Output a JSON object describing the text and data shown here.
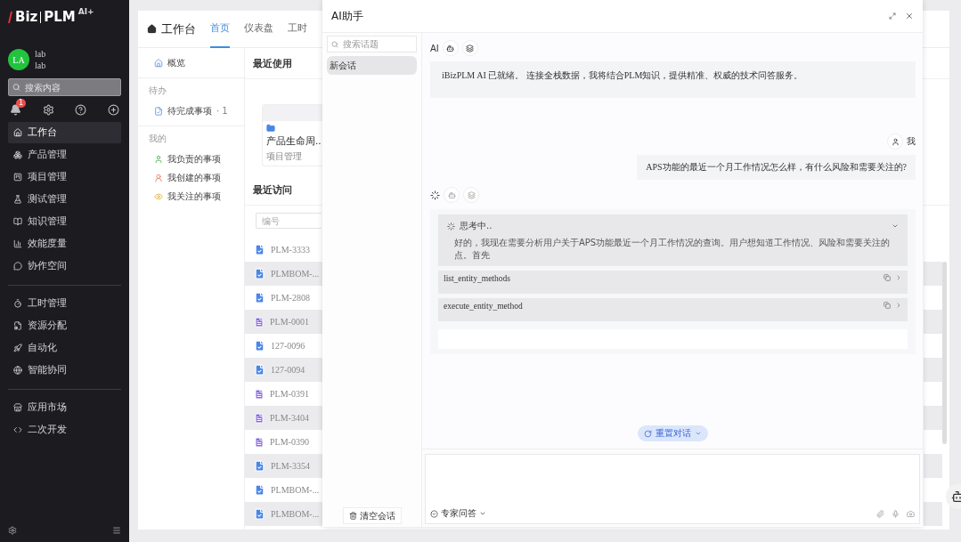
{
  "sidebar": {
    "logo": "Biz",
    "logo_product": "PLM",
    "logo_badge": "AI+",
    "user": {
      "initials": "LA",
      "name": "lab",
      "account": "lab"
    },
    "search": {
      "placeholder": "搜索内容"
    },
    "notification_count": "1",
    "nav_groups": [
      {
        "items": [
          {
            "label": "工作台",
            "selected": true
          },
          {
            "label": "产品管理",
            "selected": false
          },
          {
            "label": "项目管理",
            "selected": false
          },
          {
            "label": "测试管理",
            "selected": false
          },
          {
            "label": "知识管理",
            "selected": false
          },
          {
            "label": "效能度量",
            "selected": false
          },
          {
            "label": "协作空间",
            "selected": false
          }
        ]
      },
      {
        "items": [
          {
            "label": "工时管理",
            "selected": false
          },
          {
            "label": "资源分配",
            "selected": false
          },
          {
            "label": "自动化",
            "selected": false
          },
          {
            "label": "智能协同",
            "selected": false
          }
        ]
      },
      {
        "items": [
          {
            "label": "应用市场",
            "selected": false
          },
          {
            "label": "二次开发",
            "selected": false
          }
        ]
      }
    ]
  },
  "workbench": {
    "title": "工作台",
    "tabs": [
      {
        "label": "首页",
        "selected": true
      },
      {
        "label": "仪表盘",
        "selected": false
      },
      {
        "label": "工时",
        "selected": false
      }
    ],
    "subnav": {
      "overview": "概览",
      "sections": [
        {
          "title": "待办",
          "items": [
            {
              "label": "待完成事项",
              "count": "· 1"
            }
          ]
        },
        {
          "title": "我的",
          "items": [
            {
              "label": "我负责的事项"
            },
            {
              "label": "我创建的事项"
            },
            {
              "label": "我关注的事项"
            }
          ]
        }
      ]
    },
    "recent_used": {
      "title": "最近使用",
      "cards": [
        {
          "title": "产品生命周..",
          "subtitle": "项目管理"
        }
      ]
    },
    "recent_visits": {
      "title": "最近访问",
      "search": {
        "placeholder": "编号"
      },
      "rows": [
        {
          "kind": "task",
          "id": "PLM-3333"
        },
        {
          "kind": "task",
          "id": "PLMBOM-..."
        },
        {
          "kind": "task",
          "id": "PLM-2808"
        },
        {
          "kind": "file",
          "id": "PLM-0001"
        },
        {
          "kind": "task",
          "id": "127-0096"
        },
        {
          "kind": "task",
          "id": "127-0094"
        },
        {
          "kind": "file",
          "id": "PLM-0391"
        },
        {
          "kind": "file",
          "id": "PLM-3404"
        },
        {
          "kind": "file",
          "id": "PLM-0390"
        },
        {
          "kind": "task",
          "id": "PLM-3354"
        },
        {
          "kind": "task",
          "id": "PLMBOM-..."
        },
        {
          "kind": "task",
          "id": "PLMBOM-..."
        }
      ]
    }
  },
  "ai_assistant": {
    "title": "AI助手",
    "topic_search": {
      "placeholder": "搜索话题"
    },
    "sessions": [
      {
        "label": "新会话",
        "selected": true
      }
    ],
    "clear_button": "清空会话",
    "messages": [
      {
        "kind": "ai",
        "sender": "AI",
        "text": "iBizPLM AI 已就绪。 连接全栈数据，我将结合PLM知识，提供精准、权威的技术问答服务。"
      },
      {
        "kind": "user",
        "sender": "我",
        "text": "APS功能的最近一个月工作情况怎么样，有什么风险和需要关注的?"
      },
      {
        "kind": "ai_pending",
        "thinking": {
          "title": "思考中..",
          "expanded": true,
          "text": "好的，我现在需要分析用户关于APS功能最近一个月工作情况的查询。用户想知道工作情况、风险和需要关注的点。首先"
        },
        "tool_calls": [
          "list_entity_methods",
          "execute_entity_method"
        ]
      }
    ],
    "reset_button": "重置对话",
    "mode": "专家问答"
  }
}
